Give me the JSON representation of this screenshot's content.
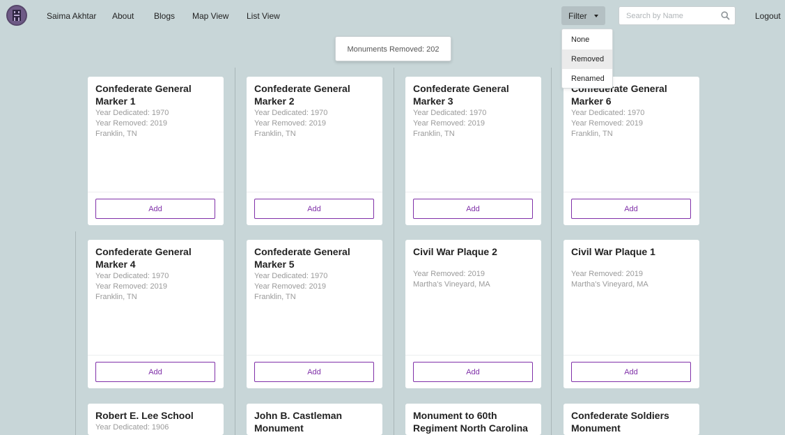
{
  "nav": {
    "user": "Saima Akhtar",
    "about": "About",
    "blogs": "Blogs",
    "map_view": "Map View",
    "list_view": "List View",
    "filter": "Filter",
    "search_placeholder": "Search by Name",
    "logout": "Logout"
  },
  "filter_menu": {
    "none": "None",
    "removed": "Removed",
    "renamed": "Renamed",
    "selected": "Removed"
  },
  "counter": "Monuments Removed: 202",
  "add_label": "Add",
  "cards": [
    {
      "title": "Confederate General Marker 1",
      "dedicated": "Year Dedicated: 1970",
      "removed": "Year Removed: 2019",
      "location": "Franklin, TN"
    },
    {
      "title": "Confederate General Marker 2",
      "dedicated": "Year Dedicated: 1970",
      "removed": "Year Removed: 2019",
      "location": "Franklin, TN"
    },
    {
      "title": "Confederate General Marker 3",
      "dedicated": "Year Dedicated: 1970",
      "removed": "Year Removed: 2019",
      "location": "Franklin, TN"
    },
    {
      "title": "Confederate General Marker 6",
      "dedicated": "Year Dedicated: 1970",
      "removed": "Year Removed: 2019",
      "location": "Franklin, TN"
    },
    {
      "title": "Confederate General Marker 4",
      "dedicated": "Year Dedicated: 1970",
      "removed": "Year Removed: 2019",
      "location": "Franklin, TN"
    },
    {
      "title": "Confederate General Marker 5",
      "dedicated": "Year Dedicated: 1970",
      "removed": "Year Removed: 2019",
      "location": "Franklin, TN"
    },
    {
      "title": "Civil War Plaque 2",
      "removed": "Year Removed: 2019",
      "location": "Martha's Vineyard, MA"
    },
    {
      "title": "Civil War Plaque 1",
      "removed": "Year Removed: 2019",
      "location": "Martha's Vineyard, MA"
    },
    {
      "title": "Robert E. Lee School",
      "dedicated": "Year Dedicated: 1906"
    },
    {
      "title": "John B. Castleman Monument"
    },
    {
      "title": "Monument to 60th Regiment North Carolina"
    },
    {
      "title": "Confederate Soldiers Monument"
    }
  ]
}
